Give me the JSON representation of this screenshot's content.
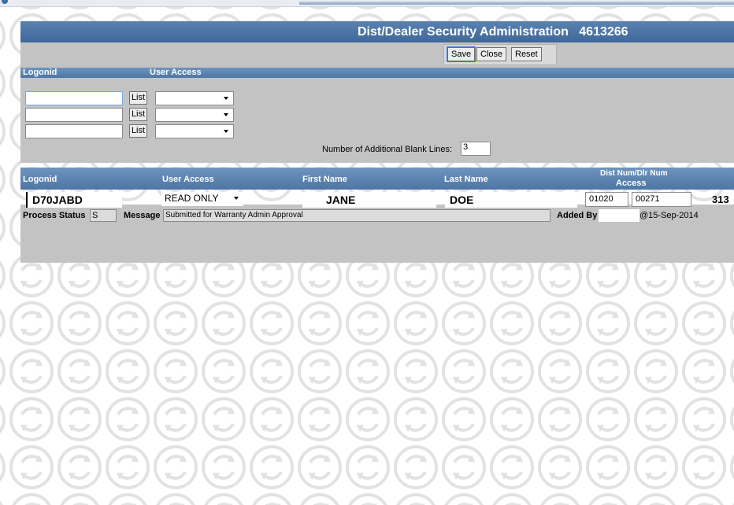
{
  "title": {
    "text": "Dist/Dealer Security Administration",
    "id": "4613266"
  },
  "toolbar": {
    "save": "Save",
    "close": "Close",
    "reset": "Reset"
  },
  "add_section": {
    "headers": {
      "logonid": "Logonid",
      "user_access": "User Access"
    },
    "rows": [
      {
        "logonid": "",
        "list": "List",
        "access": ""
      },
      {
        "logonid": "",
        "list": "List",
        "access": ""
      },
      {
        "logonid": "",
        "list": "List",
        "access": ""
      }
    ],
    "blank_lines_label": "Number of Additional Blank Lines:",
    "blank_lines_value": "3"
  },
  "users": {
    "headers": {
      "logonid": "Logonid",
      "user_access": "User Access",
      "first_name": "First Name",
      "last_name": "Last Name",
      "dist_num": "Dist Num/Dlr Num",
      "access": "Access"
    },
    "row": {
      "logonid": "D70JABD",
      "access": "READ ONLY",
      "first_name": "JANE",
      "last_name": "DOE",
      "dist": "01020",
      "dlr": "00271",
      "extra": "313"
    },
    "process_status_label": "Process Status",
    "process_status_value": "S",
    "message_label": "Message",
    "message_value": "Submitted for Warranty Admin Approval",
    "added_by_label": "Added By",
    "added_by_value": "",
    "added_date": "@15-Sep-2014"
  },
  "colors": {
    "header_blue": "#4d76a5",
    "panel_gray": "#c3c3c3"
  },
  "icons": {
    "background": "refresh-logo-icon",
    "dropdown": "chevron-down-icon"
  }
}
